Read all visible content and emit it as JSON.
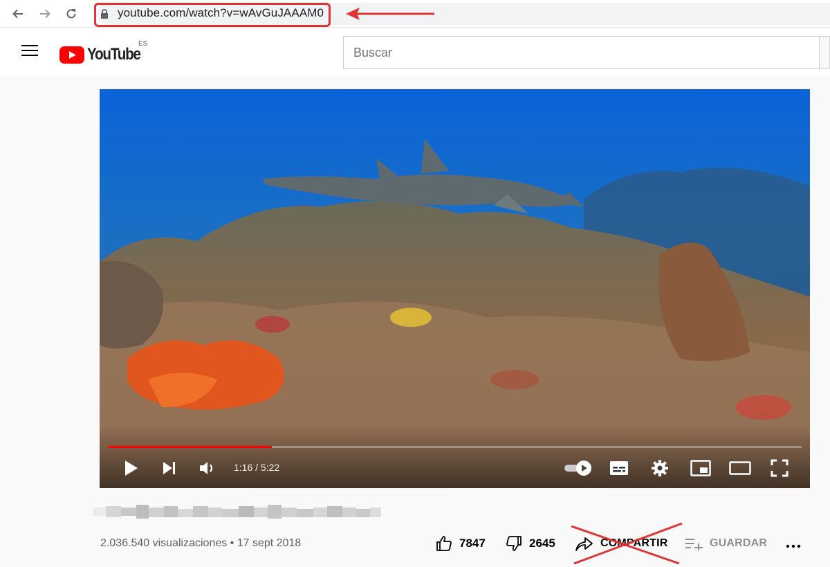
{
  "browser": {
    "url": "youtube.com/watch?v=wAvGuJAAAM0",
    "back_icon": "arrow-left-icon",
    "forward_icon": "arrow-right-icon",
    "reload_icon": "reload-icon",
    "annotation_color": "#e03333"
  },
  "header": {
    "logo_text": "YouTube",
    "region": "ES",
    "search_placeholder": "Buscar",
    "brand_color": "#ff0000"
  },
  "player": {
    "current_time": "1:16",
    "duration": "5:22",
    "time_display": "1:16 / 5:22",
    "progress_fraction": 0.236,
    "controls": [
      "play",
      "next",
      "volume",
      "autoplay-toggle",
      "subtitles",
      "settings",
      "miniplayer",
      "theater-mode",
      "fullscreen"
    ]
  },
  "video": {
    "stats": "2.036.540 visualizaciones • 17 sept 2018",
    "likes": "7847",
    "dislikes": "2645",
    "share_label": "COMPARTIR",
    "save_label": "GUARDAR"
  }
}
